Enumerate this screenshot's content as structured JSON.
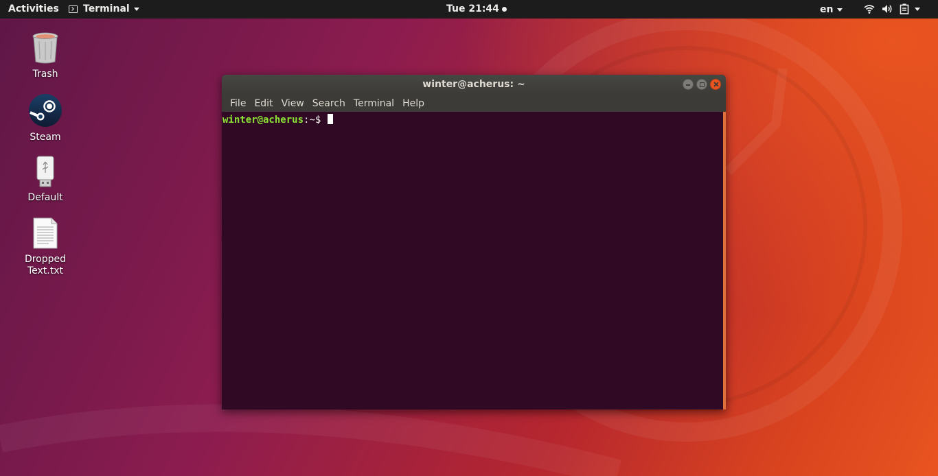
{
  "topbar": {
    "activities": "Activities",
    "app_name": "Terminal",
    "clock": "Tue 21:44",
    "language": "en"
  },
  "desktop": {
    "icons": [
      {
        "label": "Trash",
        "icon": "trash-icon"
      },
      {
        "label": "Steam",
        "icon": "steam-icon"
      },
      {
        "label": "Default",
        "icon": "usb-drive-icon"
      },
      {
        "label": "Dropped\nText.txt",
        "icon": "text-file-icon"
      }
    ]
  },
  "terminal": {
    "title": "winter@acherus: ~",
    "menu": [
      "File",
      "Edit",
      "View",
      "Search",
      "Terminal",
      "Help"
    ],
    "prompt_user_host": "winter@acherus",
    "prompt_path": ":~$ "
  },
  "colors": {
    "accent": "#e95420",
    "terminal_bg": "#300a24",
    "prompt_green": "#8ae234"
  }
}
